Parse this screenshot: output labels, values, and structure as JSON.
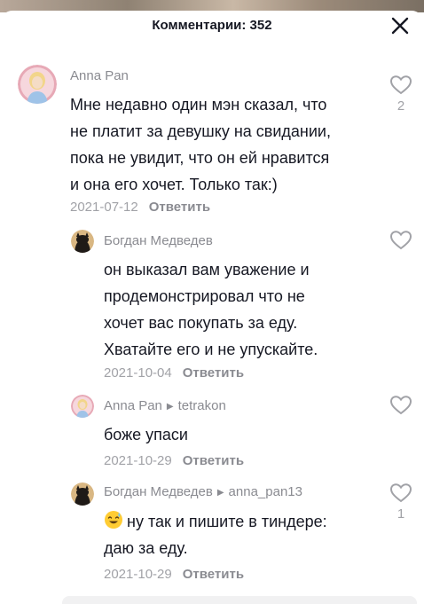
{
  "header": {
    "title": "Комментарии: 352"
  },
  "comments": [
    {
      "username": "Anna Pan",
      "text_lines": [
        "Мне недавно один мэн сказал, что",
        "не платит за девушку на свидании,",
        "пока не увидит, что он ей нравится",
        "и она его хочет. Только так:)"
      ],
      "date": "2021-07-12",
      "reply_label": "Ответить",
      "likes": "2"
    }
  ],
  "replies": [
    {
      "username": "Богдан Медведев",
      "text_lines": [
        "он выказал вам уважение и",
        "продемонстрировал что не",
        "хочет вас покупать за еду.",
        "Хватайте его и не упускайте."
      ],
      "date": "2021-10-04",
      "reply_label": "Ответить"
    },
    {
      "username": "Anna Pan",
      "reply_to": "tetrakon",
      "text_lines": [
        "боже упаси"
      ],
      "date": "2021-10-29",
      "reply_label": "Ответить"
    },
    {
      "username": "Богдан Медведев",
      "reply_to": "anna_pan13",
      "emoji": "sweat-smile-emoji",
      "text_lines": [
        "ну так и пишите в тиндере:",
        "даю за еду."
      ],
      "date": "2021-10-29",
      "reply_label": "Ответить",
      "likes": "1"
    }
  ],
  "colors": {
    "text": "#161823",
    "muted": "#a1a2a7",
    "username": "#8a8b91"
  }
}
